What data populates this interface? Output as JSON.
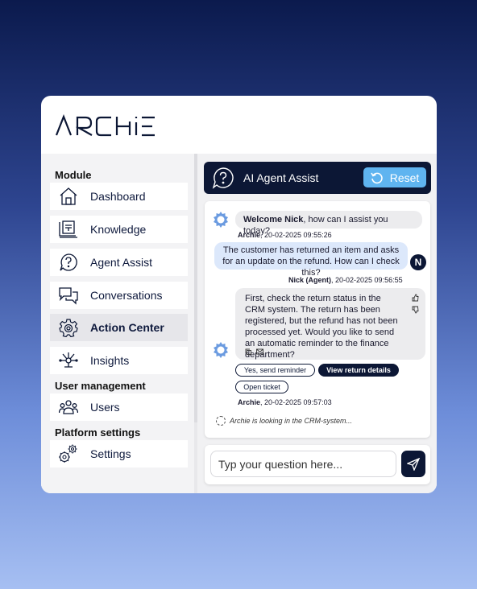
{
  "app": {
    "logo_text": "ARCHIE"
  },
  "sidebar": {
    "sections": [
      {
        "title": "Module"
      },
      {
        "title": "User management"
      },
      {
        "title": "Platform settings"
      }
    ],
    "items": [
      {
        "label": "Dashboard",
        "icon": "home-icon"
      },
      {
        "label": "Knowledge",
        "icon": "knowledge-icon"
      },
      {
        "label": "Agent Assist",
        "icon": "question-bubble-icon"
      },
      {
        "label": "Conversations",
        "icon": "chat-bubbles-icon"
      },
      {
        "label": "Action Center",
        "icon": "gear-icon",
        "active": true
      },
      {
        "label": "Insights",
        "icon": "network-insights-icon"
      },
      {
        "label": "Users",
        "icon": "users-icon"
      },
      {
        "label": "Settings",
        "icon": "gears-icon"
      }
    ]
  },
  "assist": {
    "title": "AI Agent Assist",
    "reset_label": "Reset"
  },
  "chat": {
    "welcome_bold": "Welcome Nick",
    "welcome_rest": ", how can I assist you today?",
    "meta1_name": "Archie",
    "meta1_time": ", 20-02-2025 09:55:26",
    "user_msg": "The customer has returned an item and asks for an update on the refund. How can I check this?",
    "user_initial": "N",
    "meta2_name": "Nick (Agent)",
    "meta2_time": ", 20-02-2025 09:56:55",
    "bot_reply": "First, check the return status in the CRM system. The return has been registered, but the refund has not been processed yet. Would you like to send an automatic reminder to the finance department?",
    "quick_replies": [
      "Yes, send reminder",
      "View return details",
      "Open ticket"
    ],
    "meta3_name": "Archie",
    "meta3_time": ", 20-02-2025 09:57:03",
    "status": "Archie is looking in the CRM-system..."
  },
  "input": {
    "placeholder": "Typ your question here..."
  },
  "colors": {
    "navy": "#0c1735",
    "accent": "#5fb4f0",
    "user_bubble": "#dce8fb",
    "bot_bubble": "#ececee"
  }
}
